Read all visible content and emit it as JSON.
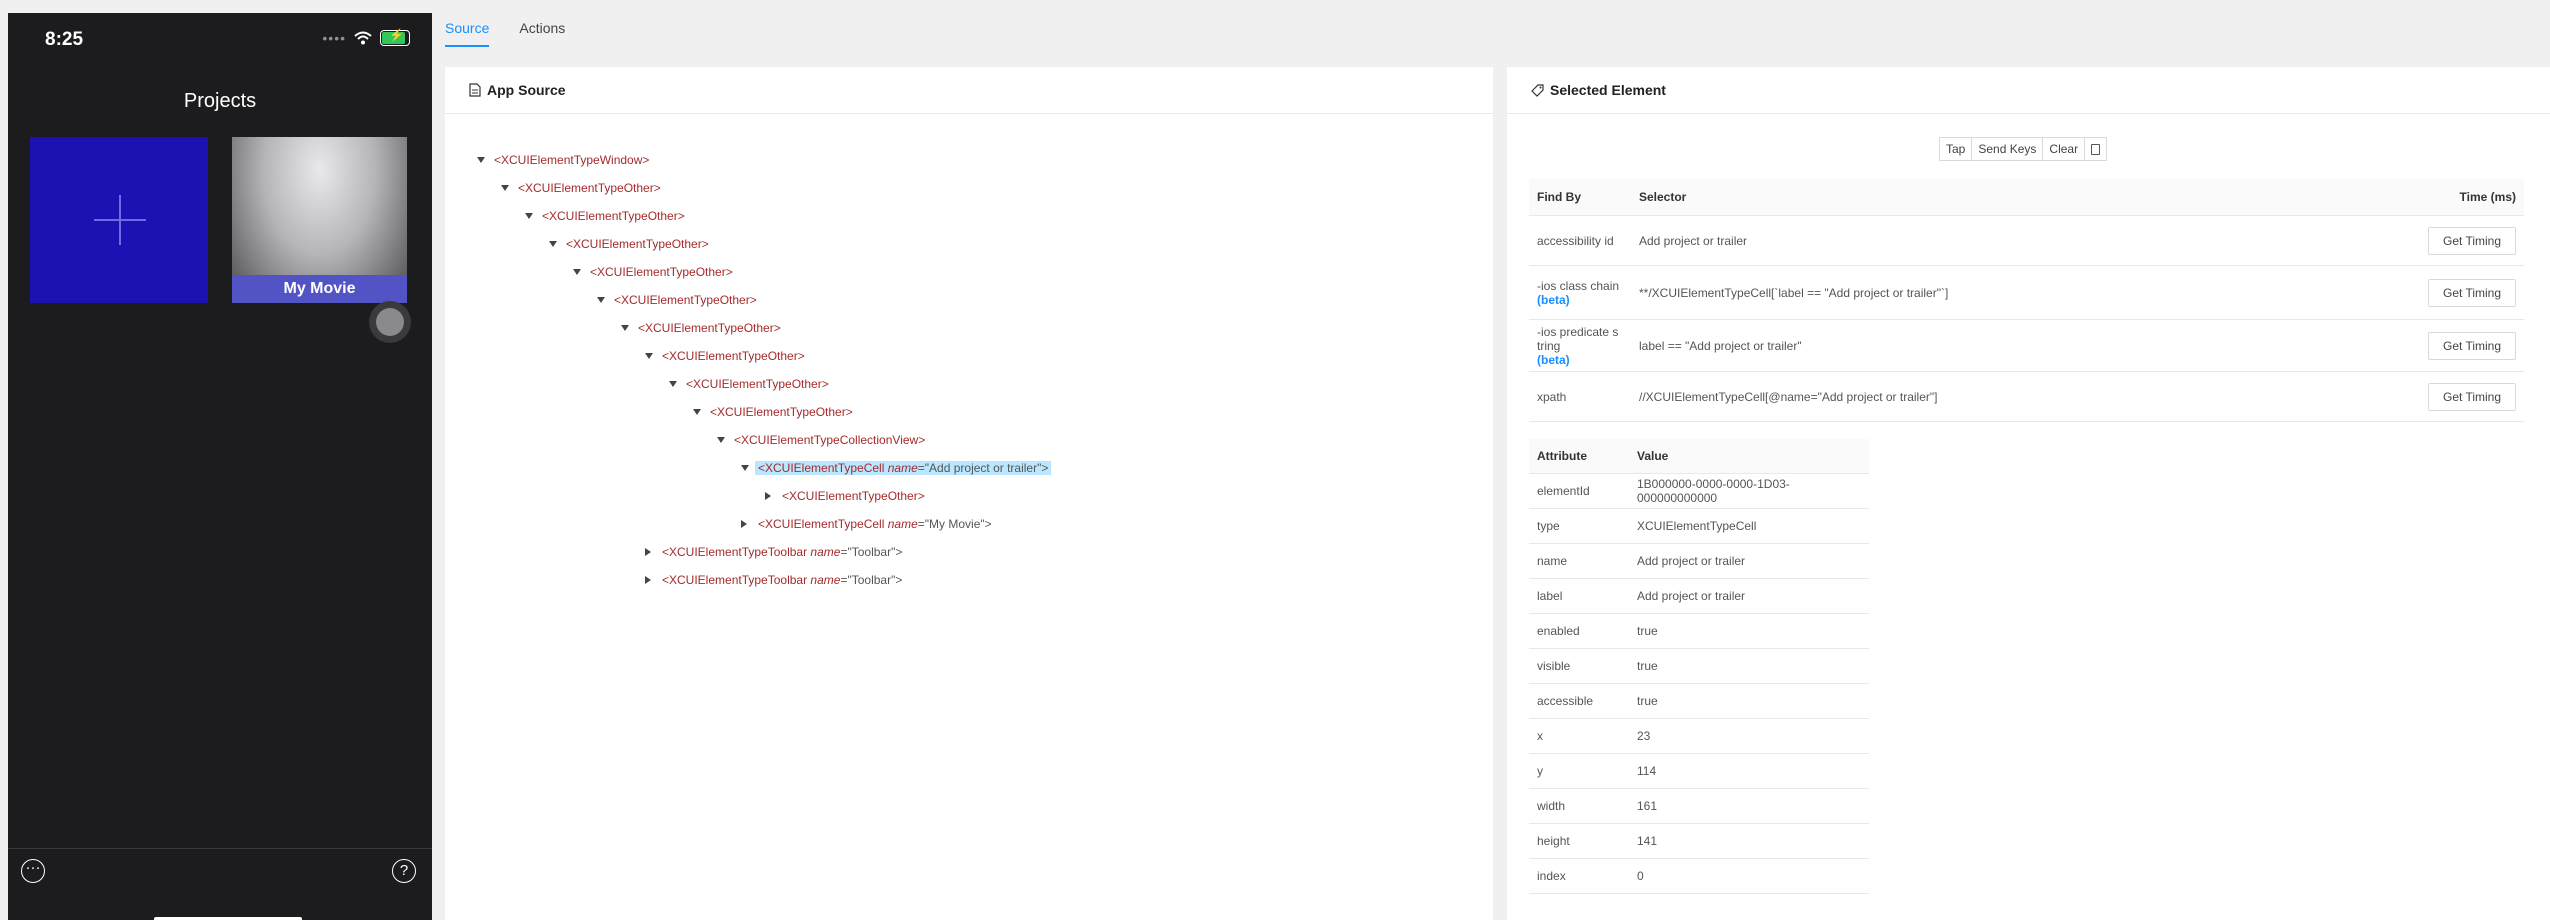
{
  "device": {
    "time": "8:25",
    "title": "Projects",
    "movie_label": "My Movie"
  },
  "tabs": [
    "Source",
    "Actions"
  ],
  "source": {
    "header": "App Source",
    "tree": [
      {
        "depth": 0,
        "caret": "down",
        "tag": "<XCUIElementTypeWindow>"
      },
      {
        "depth": 1,
        "caret": "down",
        "tag": "<XCUIElementTypeOther>"
      },
      {
        "depth": 2,
        "caret": "down",
        "tag": "<XCUIElementTypeOther>"
      },
      {
        "depth": 3,
        "caret": "down",
        "tag": "<XCUIElementTypeOther>"
      },
      {
        "depth": 4,
        "caret": "down",
        "tag": "<XCUIElementTypeOther>"
      },
      {
        "depth": 5,
        "caret": "down",
        "tag": "<XCUIElementTypeOther>"
      },
      {
        "depth": 6,
        "caret": "down",
        "tag": "<XCUIElementTypeOther>"
      },
      {
        "depth": 7,
        "caret": "down",
        "tag": "<XCUIElementTypeOther>"
      },
      {
        "depth": 8,
        "caret": "down",
        "tag": "<XCUIElementTypeOther>"
      },
      {
        "depth": 9,
        "caret": "down",
        "tag": "<XCUIElementTypeOther>"
      },
      {
        "depth": 10,
        "caret": "down",
        "tag": "<XCUIElementTypeCollectionView>"
      },
      {
        "depth": 11,
        "caret": "down",
        "tag": "<XCUIElementTypeCell",
        "attr_name": "name",
        "attr_value": "=\"Add project or trailer\">",
        "selected": true
      },
      {
        "depth": 12,
        "caret": "right",
        "tag": "<XCUIElementTypeOther>"
      },
      {
        "depth": 11,
        "caret": "right",
        "tag": "<XCUIElementTypeCell",
        "attr_name": "name",
        "attr_value": "=\"My Movie\">"
      },
      {
        "depth": 7,
        "caret": "right",
        "tag": "<XCUIElementTypeToolbar",
        "attr_name": "name",
        "attr_value": "=\"Toolbar\">"
      },
      {
        "depth": 7,
        "caret": "right",
        "tag": "<XCUIElementTypeToolbar",
        "attr_name": "name",
        "attr_value": "=\"Toolbar\">"
      }
    ]
  },
  "selected": {
    "header": "Selected Element",
    "buttons": {
      "tap": "Tap",
      "send_keys": "Send Keys",
      "clear": "Clear"
    },
    "find_headers": {
      "find_by": "Find By",
      "selector": "Selector",
      "time": "Time (ms)"
    },
    "get_timing": "Get Timing",
    "find_rows": [
      {
        "find_by": "accessibility id",
        "beta": "",
        "selector": "Add project or trailer"
      },
      {
        "find_by": "-ios class chain",
        "beta": "(beta)",
        "selector": "**/XCUIElementTypeCell[`label == \"Add project or trailer\"`]"
      },
      {
        "find_by": "-ios predicate s tring",
        "beta": "(beta)",
        "selector": "label == \"Add project or trailer\""
      },
      {
        "find_by": "xpath",
        "beta": "",
        "selector": "//XCUIElementTypeCell[@name=\"Add project or trailer\"]"
      }
    ],
    "attr_headers": {
      "attribute": "Attribute",
      "value": "Value"
    },
    "attributes": [
      {
        "name": "elementId",
        "value": "1B000000-0000-0000-1D03-000000000000"
      },
      {
        "name": "type",
        "value": "XCUIElementTypeCell"
      },
      {
        "name": "name",
        "value": "Add project or trailer"
      },
      {
        "name": "label",
        "value": "Add project or trailer"
      },
      {
        "name": "enabled",
        "value": "true"
      },
      {
        "name": "visible",
        "value": "true"
      },
      {
        "name": "accessible",
        "value": "true"
      },
      {
        "name": "x",
        "value": "23"
      },
      {
        "name": "y",
        "value": "114"
      },
      {
        "name": "width",
        "value": "161"
      },
      {
        "name": "height",
        "value": "141"
      },
      {
        "name": "index",
        "value": "0"
      }
    ]
  }
}
